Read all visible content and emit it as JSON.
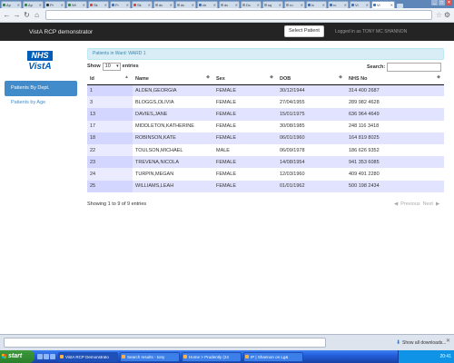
{
  "browser": {
    "tabs": [
      {
        "label": "Ap",
        "color": "#2e8b3a"
      },
      {
        "label": "Ap",
        "color": "#2e8b3a"
      },
      {
        "label": "Pr",
        "color": "#333333"
      },
      {
        "label": "Wi",
        "color": "#2e8b3a"
      },
      {
        "label": "Sk",
        "color": "#d44638"
      },
      {
        "label": "Fr",
        "color": "#3b73b9"
      },
      {
        "label": "Sk",
        "color": "#d44638"
      },
      {
        "label": "dc",
        "color": "#999999"
      },
      {
        "label": "dc",
        "color": "#999999"
      },
      {
        "label": "ch",
        "color": "#3b73b9"
      },
      {
        "label": "dc",
        "color": "#999999"
      },
      {
        "label": "Dc",
        "color": "#999999"
      },
      {
        "label": "sq",
        "color": "#999999"
      },
      {
        "label": "ro",
        "color": "#999999"
      },
      {
        "label": "Ic",
        "color": "#3b73b9"
      },
      {
        "label": "rc",
        "color": "#3b73b9"
      },
      {
        "label": "Vi",
        "color": "#3b73b9"
      }
    ],
    "active_tab": {
      "label": "Vi",
      "color": "#3b73b9"
    }
  },
  "app": {
    "brand": "VistA RCP demonstrator",
    "select_patient": "Select Patient",
    "logged_in": "Logged in as  TONY MC SHANNON"
  },
  "sidebar": {
    "logo_nhs": "NHS",
    "logo_vista": "VistA",
    "nav": [
      {
        "label": "Patients By Dept.",
        "active": true
      },
      {
        "label": "Patients by Age",
        "active": false
      }
    ]
  },
  "main": {
    "ward_label": "Patients in Ward: WARD 1",
    "show_label": "Show",
    "entries_label": "entries",
    "page_length": "10",
    "search_label": "Search:",
    "search_value": "",
    "columns": [
      "Id",
      "Name",
      "Sex",
      "DOB",
      "NHS No"
    ],
    "rows": [
      [
        "1",
        "ALDEN,GEORGIA",
        "FEMALE",
        "30/12/1944",
        "314 400 2687"
      ],
      [
        "3",
        "BLOGGS,OLIVIA",
        "FEMALE",
        "27/04/1955",
        "289 982 4628"
      ],
      [
        "13",
        "DAVIES,JANE",
        "FEMALE",
        "15/01/1975",
        "636 964 4649"
      ],
      [
        "17",
        "MIDDLETON,KATHERINE",
        "FEMALE",
        "30/08/1985",
        "248 116 3418"
      ],
      [
        "18",
        "ROBINSON,KATE",
        "FEMALE",
        "06/01/1960",
        "164 819 8025"
      ],
      [
        "22",
        "TOULSON,MICHAEL",
        "MALE",
        "06/09/1978",
        "186 626 9352"
      ],
      [
        "23",
        "TREVENA,NICOLA",
        "FEMALE",
        "14/08/1954",
        "941 353 6085"
      ],
      [
        "24",
        "TURPIN,MEGAN",
        "FEMALE",
        "12/03/1960",
        "409 491 2280"
      ],
      [
        "25",
        "WILLIAMS,LEAH",
        "FEMALE",
        "01/01/1962",
        "500 198 2434"
      ]
    ],
    "info": "Showing 1 to 9 of 9 entries",
    "prev_label": "Previous",
    "next_label": "Next"
  },
  "downloads": {
    "show_all": "Show all downloads..."
  },
  "taskbar": {
    "start": "start",
    "buttons": [
      {
        "label": "VistA RCP Demonstrato",
        "active": true
      },
      {
        "label": "Search results - tony",
        "active": false
      },
      {
        "label": "Home > Prudently (24",
        "active": false
      },
      {
        "label": "IP | Shannon on Lg&",
        "active": false
      }
    ],
    "clock": "20:41"
  }
}
